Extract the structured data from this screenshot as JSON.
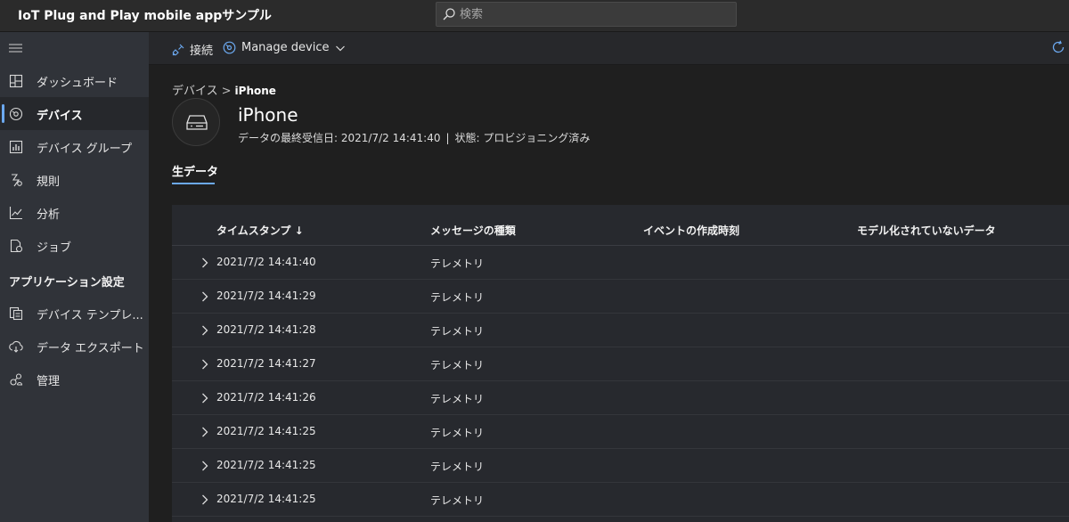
{
  "app": {
    "title": "IoT Plug and Play mobile appサンプル"
  },
  "search": {
    "placeholder": "検索"
  },
  "sidebar": {
    "items": [
      {
        "label": "ダッシュボード",
        "icon": "dashboard-icon"
      },
      {
        "label": "デバイス",
        "icon": "device-icon",
        "active": true
      },
      {
        "label": "デバイス グループ",
        "icon": "device-group-icon"
      },
      {
        "label": "規則",
        "icon": "rules-icon"
      },
      {
        "label": "分析",
        "icon": "analytics-icon"
      },
      {
        "label": "ジョブ",
        "icon": "jobs-icon"
      }
    ],
    "section_title": "アプリケーション設定",
    "settings_items": [
      {
        "label": "デバイス テンプレ...",
        "icon": "device-template-icon"
      },
      {
        "label": "データ エクスポート",
        "icon": "data-export-icon"
      },
      {
        "label": "管理",
        "icon": "admin-icon"
      }
    ]
  },
  "toolbar": {
    "connect_label": "接続",
    "manage_label": "Manage device"
  },
  "breadcrumb": {
    "parent": "デバイス",
    "separator": ">",
    "current": "iPhone"
  },
  "device": {
    "name": "iPhone",
    "last_received": "データの最終受信日: 2021/7/2 14:41:40",
    "separator": "|",
    "status": "状態: プロビジョニング済み"
  },
  "tabs": {
    "raw_data": "生データ"
  },
  "table": {
    "columns": [
      "タイムスタンプ ↓",
      "メッセージの種類",
      "イベントの作成時刻",
      "モデル化されていないデータ"
    ],
    "rows": [
      {
        "timestamp": "2021/7/2 14:41:40",
        "type": "テレメトリ"
      },
      {
        "timestamp": "2021/7/2 14:41:29",
        "type": "テレメトリ"
      },
      {
        "timestamp": "2021/7/2 14:41:28",
        "type": "テレメトリ"
      },
      {
        "timestamp": "2021/7/2 14:41:27",
        "type": "テレメトリ"
      },
      {
        "timestamp": "2021/7/2 14:41:26",
        "type": "テレメトリ"
      },
      {
        "timestamp": "2021/7/2 14:41:25",
        "type": "テレメトリ"
      },
      {
        "timestamp": "2021/7/2 14:41:25",
        "type": "テレメトリ"
      },
      {
        "timestamp": "2021/7/2 14:41:25",
        "type": "テレメトリ"
      }
    ]
  },
  "colors": {
    "accent": "#6ca9f0"
  }
}
